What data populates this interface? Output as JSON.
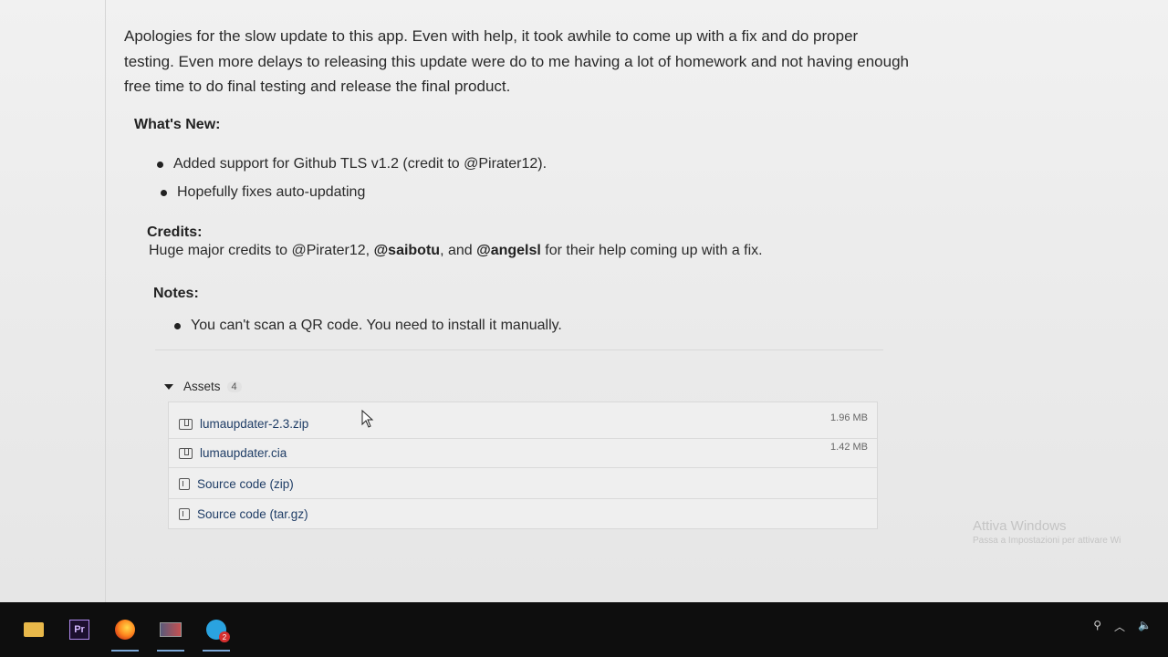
{
  "release": {
    "intro": "Apologies for the slow update to this app. Even with help, it took awhile to come up with a fix and do proper testing. Even more delays to releasing this update were do to me having a lot of homework and not having enough free time to do final testing and release the final product.",
    "whats_new_heading": "What's New:",
    "whats_new_items": [
      "Added support for Github TLS v1.2 (credit to @Pirater12).",
      "Hopefully fixes auto-updating"
    ],
    "credits_heading": "Credits:",
    "credits_prefix": "Huge major credits to @Pirater12, ",
    "credits_user1": "@saibotu",
    "credits_mid": ", and ",
    "credits_user2": "@angelsl",
    "credits_suffix": " for their help coming up with a fix.",
    "notes_heading": "Notes:",
    "notes_items": [
      "You can't scan a QR code. You need to install it manually."
    ]
  },
  "assets": {
    "label": "Assets",
    "count": "4",
    "items": [
      {
        "name": "lumaupdater-2.3.zip",
        "size": "1.96 MB",
        "icon": "package-icon"
      },
      {
        "name": "lumaupdater.cia",
        "size": "1.42 MB",
        "icon": "package-icon"
      },
      {
        "name": "Source code (zip)",
        "size": "",
        "icon": "file-zip-icon"
      },
      {
        "name": "Source code (tar.gz)",
        "size": "",
        "icon": "file-zip-icon"
      }
    ]
  },
  "watermark": {
    "title": "Attiva Windows",
    "subtitle": "Passa a Impostazioni per attivare Wi"
  },
  "taskbar": {
    "apps": [
      "file-explorer-icon",
      "premiere-icon",
      "firefox-icon",
      "app-icon",
      "telegram-icon"
    ],
    "premiere_label": "Pr",
    "telegram_badge": "2"
  }
}
